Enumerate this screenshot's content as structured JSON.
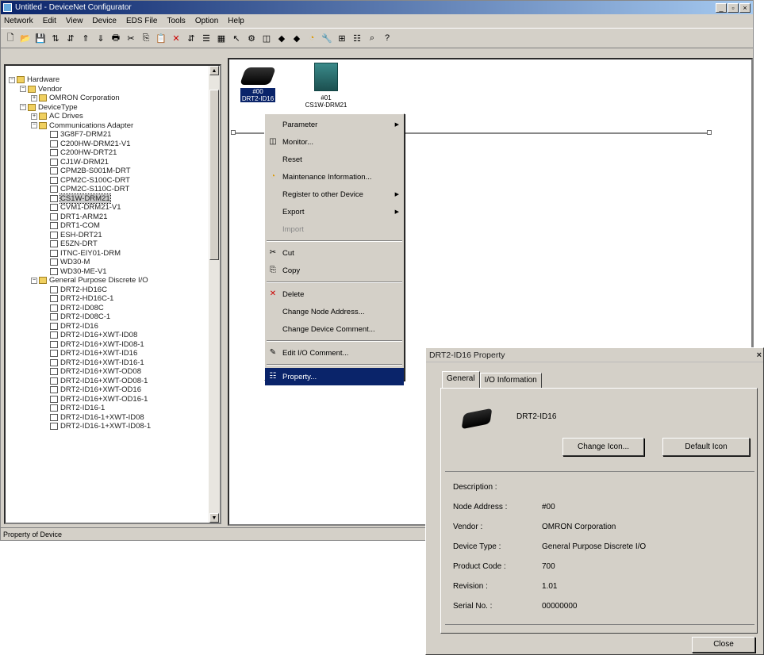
{
  "app": {
    "title": "Untitled - DeviceNet Configurator",
    "menu": [
      "Network",
      "Edit",
      "View",
      "Device",
      "EDS File",
      "Tools",
      "Option",
      "Help"
    ],
    "status": "Property of Device"
  },
  "tree": [
    {
      "t": "Hardware",
      "d": 0,
      "k": "folder",
      "pm": "−"
    },
    {
      "t": "Vendor",
      "d": 1,
      "k": "folder",
      "pm": "−"
    },
    {
      "t": "OMRON Corporation",
      "d": 2,
      "k": "folder",
      "pm": "+"
    },
    {
      "t": "DeviceType",
      "d": 1,
      "k": "folder",
      "pm": "−"
    },
    {
      "t": "AC Drives",
      "d": 2,
      "k": "folder",
      "pm": "+"
    },
    {
      "t": "Communications Adapter",
      "d": 2,
      "k": "folder",
      "pm": "−"
    },
    {
      "t": "3G8F7-DRM21",
      "d": 3,
      "k": "dev"
    },
    {
      "t": "C200HW-DRM21-V1",
      "d": 3,
      "k": "dev"
    },
    {
      "t": "C200HW-DRT21",
      "d": 3,
      "k": "dev"
    },
    {
      "t": "CJ1W-DRM21",
      "d": 3,
      "k": "dev"
    },
    {
      "t": "CPM2B-S001M-DRT",
      "d": 3,
      "k": "dev"
    },
    {
      "t": "CPM2C-S100C-DRT",
      "d": 3,
      "k": "dev"
    },
    {
      "t": "CPM2C-S110C-DRT",
      "d": 3,
      "k": "dev"
    },
    {
      "t": "CS1W-DRM21",
      "d": 3,
      "k": "dev",
      "sel": true
    },
    {
      "t": "CVM1-DRM21-V1",
      "d": 3,
      "k": "dev"
    },
    {
      "t": "DRT1-ARM21",
      "d": 3,
      "k": "dev"
    },
    {
      "t": "DRT1-COM",
      "d": 3,
      "k": "dev"
    },
    {
      "t": "ESH-DRT21",
      "d": 3,
      "k": "dev"
    },
    {
      "t": "E5ZN-DRT",
      "d": 3,
      "k": "dev"
    },
    {
      "t": "ITNC-EIY01-DRM",
      "d": 3,
      "k": "dev"
    },
    {
      "t": "WD30-M",
      "d": 3,
      "k": "dev"
    },
    {
      "t": "WD30-ME-V1",
      "d": 3,
      "k": "dev"
    },
    {
      "t": "General Purpose Discrete I/O",
      "d": 2,
      "k": "folder",
      "pm": "−"
    },
    {
      "t": "DRT2-HD16C",
      "d": 3,
      "k": "dev"
    },
    {
      "t": "DRT2-HD16C-1",
      "d": 3,
      "k": "dev"
    },
    {
      "t": "DRT2-ID08C",
      "d": 3,
      "k": "dev"
    },
    {
      "t": "DRT2-ID08C-1",
      "d": 3,
      "k": "dev"
    },
    {
      "t": "DRT2-ID16",
      "d": 3,
      "k": "dev"
    },
    {
      "t": "DRT2-ID16+XWT-ID08",
      "d": 3,
      "k": "dev"
    },
    {
      "t": "DRT2-ID16+XWT-ID08-1",
      "d": 3,
      "k": "dev"
    },
    {
      "t": "DRT2-ID16+XWT-ID16",
      "d": 3,
      "k": "dev"
    },
    {
      "t": "DRT2-ID16+XWT-ID16-1",
      "d": 3,
      "k": "dev"
    },
    {
      "t": "DRT2-ID16+XWT-OD08",
      "d": 3,
      "k": "dev"
    },
    {
      "t": "DRT2-ID16+XWT-OD08-1",
      "d": 3,
      "k": "dev"
    },
    {
      "t": "DRT2-ID16+XWT-OD16",
      "d": 3,
      "k": "dev"
    },
    {
      "t": "DRT2-ID16+XWT-OD16-1",
      "d": 3,
      "k": "dev"
    },
    {
      "t": "DRT2-ID16-1",
      "d": 3,
      "k": "dev"
    },
    {
      "t": "DRT2-ID16-1+XWT-ID08",
      "d": 3,
      "k": "dev"
    },
    {
      "t": "DRT2-ID16-1+XWT-ID08-1",
      "d": 3,
      "k": "dev"
    }
  ],
  "canvas": {
    "node0": {
      "addr": "#00",
      "name": "DRT2-ID16"
    },
    "node1": {
      "addr": "#01",
      "name": "CS1W-DRM21"
    }
  },
  "context_menu": [
    {
      "label": "Parameter",
      "sub": true
    },
    {
      "label": "Monitor...",
      "icon": "monitor-icon"
    },
    {
      "label": "Reset"
    },
    {
      "label": "Maintenance Information...",
      "icon": "maintenance-icon"
    },
    {
      "label": "Register to other Device",
      "sub": true
    },
    {
      "label": "Export",
      "sub": true
    },
    {
      "label": "Import",
      "dis": true
    },
    {
      "sep": true
    },
    {
      "label": "Cut",
      "icon": "cut-icon"
    },
    {
      "label": "Copy",
      "icon": "copy-icon"
    },
    {
      "sep": true
    },
    {
      "label": "Delete",
      "icon": "delete-icon"
    },
    {
      "label": "Change Node Address..."
    },
    {
      "label": "Change Device Comment..."
    },
    {
      "sep": true
    },
    {
      "label": "Edit I/O Comment...",
      "icon": "edit-io-icon"
    },
    {
      "sep": true
    },
    {
      "label": "Property...",
      "icon": "property-icon",
      "hl": true
    }
  ],
  "dialog": {
    "title": "DRT2-ID16 Property",
    "tabs": [
      "General",
      "I/O Information"
    ],
    "device_name": "DRT2-ID16",
    "change_icon": "Change Icon...",
    "default_icon": "Default Icon",
    "props": [
      {
        "k": "Description :",
        "v": ""
      },
      {
        "k": "Node Address :",
        "v": "#00"
      },
      {
        "k": "Vendor :",
        "v": "OMRON Corporation"
      },
      {
        "k": "Device Type :",
        "v": "General Purpose Discrete I/O"
      },
      {
        "k": "Product Code :",
        "v": "700"
      },
      {
        "k": "Revision :",
        "v": "1.01"
      },
      {
        "k": "Serial No. :",
        "v": "00000000"
      }
    ],
    "close": "Close"
  }
}
